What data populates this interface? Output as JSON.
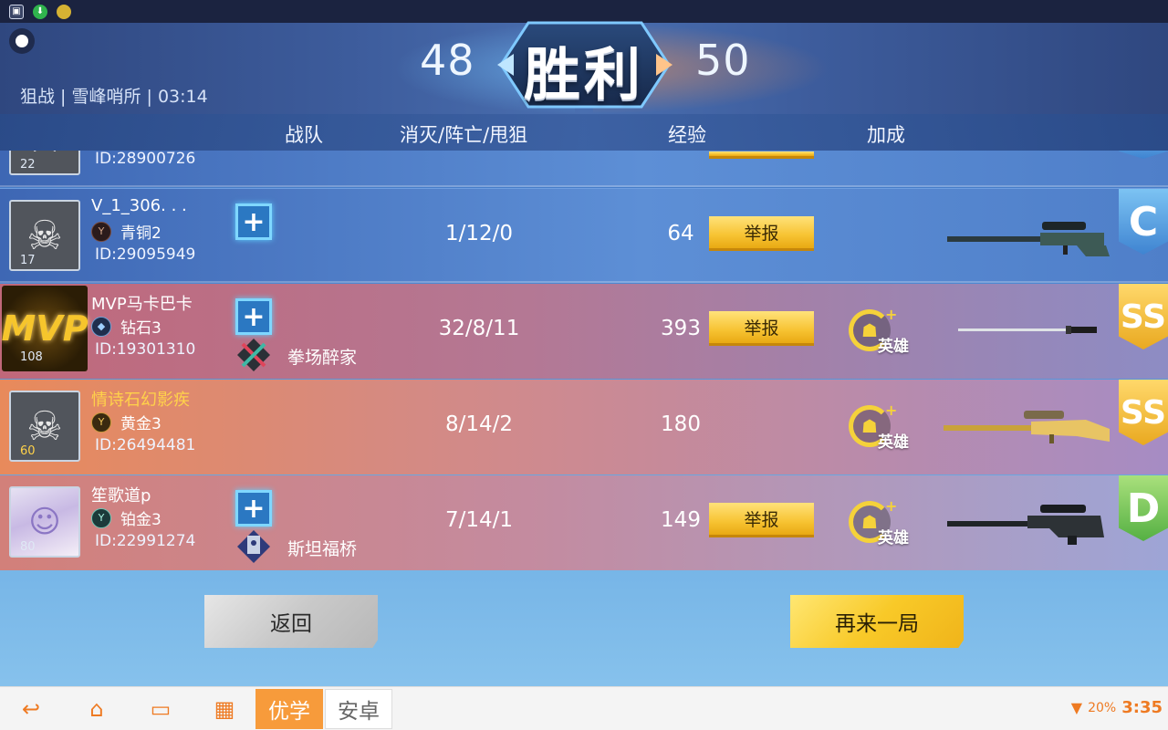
{
  "status_icons": [
    "image-icon",
    "download-icon",
    "coin-icon"
  ],
  "header": {
    "map_info": "狙战 | 雪峰哨所 | 03:14",
    "score_left": "48",
    "score_right": "50",
    "result": "胜利"
  },
  "columns": {
    "team": "战队",
    "kda": "消灭/阵亡/甩狙",
    "exp": "经验",
    "bonus": "加成"
  },
  "rows": [
    {
      "id": "ID:28900726",
      "level": "22"
    },
    {
      "name": "V_1_306. . .",
      "rank": "青铜2",
      "id": "ID:29095949",
      "level": "17",
      "kda": "1/12/0",
      "exp": "64",
      "report": "举报",
      "grade": "C"
    },
    {
      "name": "MVP马卡巴卡",
      "rank": "钻石3",
      "id": "ID:19301310",
      "level": "108",
      "team": "拳场醉家",
      "kda": "32/8/11",
      "exp": "393",
      "report": "举报",
      "bonus": "英雄",
      "grade": "SS",
      "mvp_label": "MVP"
    },
    {
      "name": "情诗石幻影疾",
      "rank": "黄金3",
      "id": "ID:26494481",
      "level": "60",
      "kda": "8/14/2",
      "exp": "180",
      "bonus": "英雄",
      "grade": "SS"
    },
    {
      "name": "笙歌道p",
      "rank": "铂金3",
      "id": "ID:22991274",
      "level": "80",
      "team": "斯坦福桥",
      "kda": "7/14/1",
      "exp": "149",
      "report": "举报",
      "bonus": "英雄",
      "grade": "D"
    }
  ],
  "buttons": {
    "back": "返回",
    "again": "再来一局"
  },
  "navbar": {
    "app1": "优学",
    "app2": "安卓",
    "battery": "20%",
    "time": "3:35"
  },
  "colors": {
    "accent_yellow": "#f7c332",
    "nav_orange": "#ee7a22"
  }
}
